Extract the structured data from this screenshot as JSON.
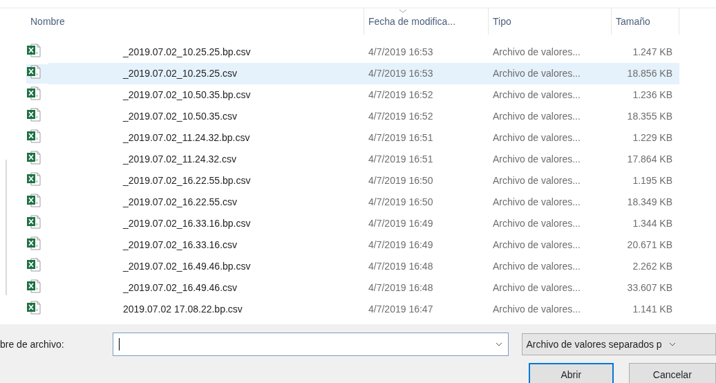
{
  "columns": [
    {
      "label": "Nombre",
      "sorted": false
    },
    {
      "label": "Fecha de modifica...",
      "sorted": true
    },
    {
      "label": "Tipo",
      "sorted": false
    },
    {
      "label": "Tamaño",
      "sorted": false
    }
  ],
  "files": [
    {
      "name": "_2019.07.02_10.25.25.bp.csv",
      "modified": "4/7/2019 16:53",
      "type": "Archivo de valores...",
      "size": "1.247 KB",
      "selected": false
    },
    {
      "name": "_2019.07.02_10.25.25.csv",
      "modified": "4/7/2019 16:53",
      "type": "Archivo de valores...",
      "size": "18.856 KB",
      "selected": true
    },
    {
      "name": "_2019.07.02_10.50.35.bp.csv",
      "modified": "4/7/2019 16:52",
      "type": "Archivo de valores...",
      "size": "1.236 KB",
      "selected": false
    },
    {
      "name": "_2019.07.02_10.50.35.csv",
      "modified": "4/7/2019 16:52",
      "type": "Archivo de valores...",
      "size": "18.355 KB",
      "selected": false
    },
    {
      "name": "_2019.07.02_11.24.32.bp.csv",
      "modified": "4/7/2019 16:51",
      "type": "Archivo de valores...",
      "size": "1.229 KB",
      "selected": false
    },
    {
      "name": "_2019.07.02_11.24.32.csv",
      "modified": "4/7/2019 16:51",
      "type": "Archivo de valores...",
      "size": "17.864 KB",
      "selected": false
    },
    {
      "name": "_2019.07.02_16.22.55.bp.csv",
      "modified": "4/7/2019 16:50",
      "type": "Archivo de valores...",
      "size": "1.195 KB",
      "selected": false
    },
    {
      "name": "_2019.07.02_16.22.55.csv",
      "modified": "4/7/2019 16:50",
      "type": "Archivo de valores...",
      "size": "18.349 KB",
      "selected": false
    },
    {
      "name": "_2019.07.02_16.33.16.bp.csv",
      "modified": "4/7/2019 16:49",
      "type": "Archivo de valores...",
      "size": "1.344 KB",
      "selected": false
    },
    {
      "name": "_2019.07.02_16.33.16.csv",
      "modified": "4/7/2019 16:49",
      "type": "Archivo de valores...",
      "size": "20.671 KB",
      "selected": false
    },
    {
      "name": "_2019.07.02_16.49.46.bp.csv",
      "modified": "4/7/2019 16:48",
      "type": "Archivo de valores...",
      "size": "2.262 KB",
      "selected": false
    },
    {
      "name": "_2019.07.02_16.49.46.csv",
      "modified": "4/7/2019 16:48",
      "type": "Archivo de valores...",
      "size": "33.607 KB",
      "selected": false
    },
    {
      "name": "2019.07.02 17.08.22.bp.csv",
      "modified": "4/7/2019 16:47",
      "type": "Archivo de valores...",
      "size": "1.141 KB",
      "selected": false
    }
  ],
  "filename": {
    "label": "bre de archivo:"
  },
  "file_type": {
    "value": "Archivo de valores separados p"
  },
  "buttons": [
    {
      "label": "Abrir",
      "kind": "default"
    },
    {
      "label": "Cancelar",
      "kind": "normal"
    }
  ]
}
